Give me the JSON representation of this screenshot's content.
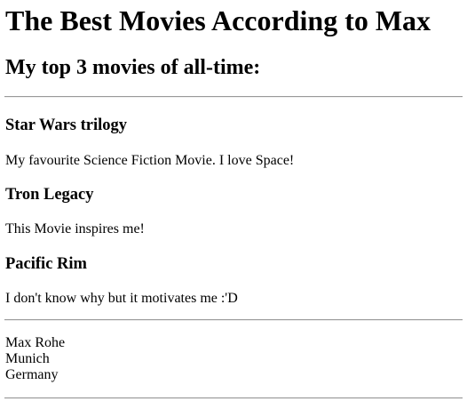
{
  "page": {
    "title": "The Best Movies According to Max",
    "subtitle": "My top 3 movies of all-time:"
  },
  "movies": [
    {
      "title": "Star Wars trilogy",
      "description": "My favourite Science Fiction Movie. I love Space!"
    },
    {
      "title": "Tron Legacy",
      "description": "This Movie inspires me!"
    },
    {
      "title": "Pacific Rim",
      "description": "I don't know why but it motivates me :'D"
    }
  ],
  "contact": {
    "name": "Max Rohe",
    "city": "Munich",
    "country": "Germany"
  }
}
